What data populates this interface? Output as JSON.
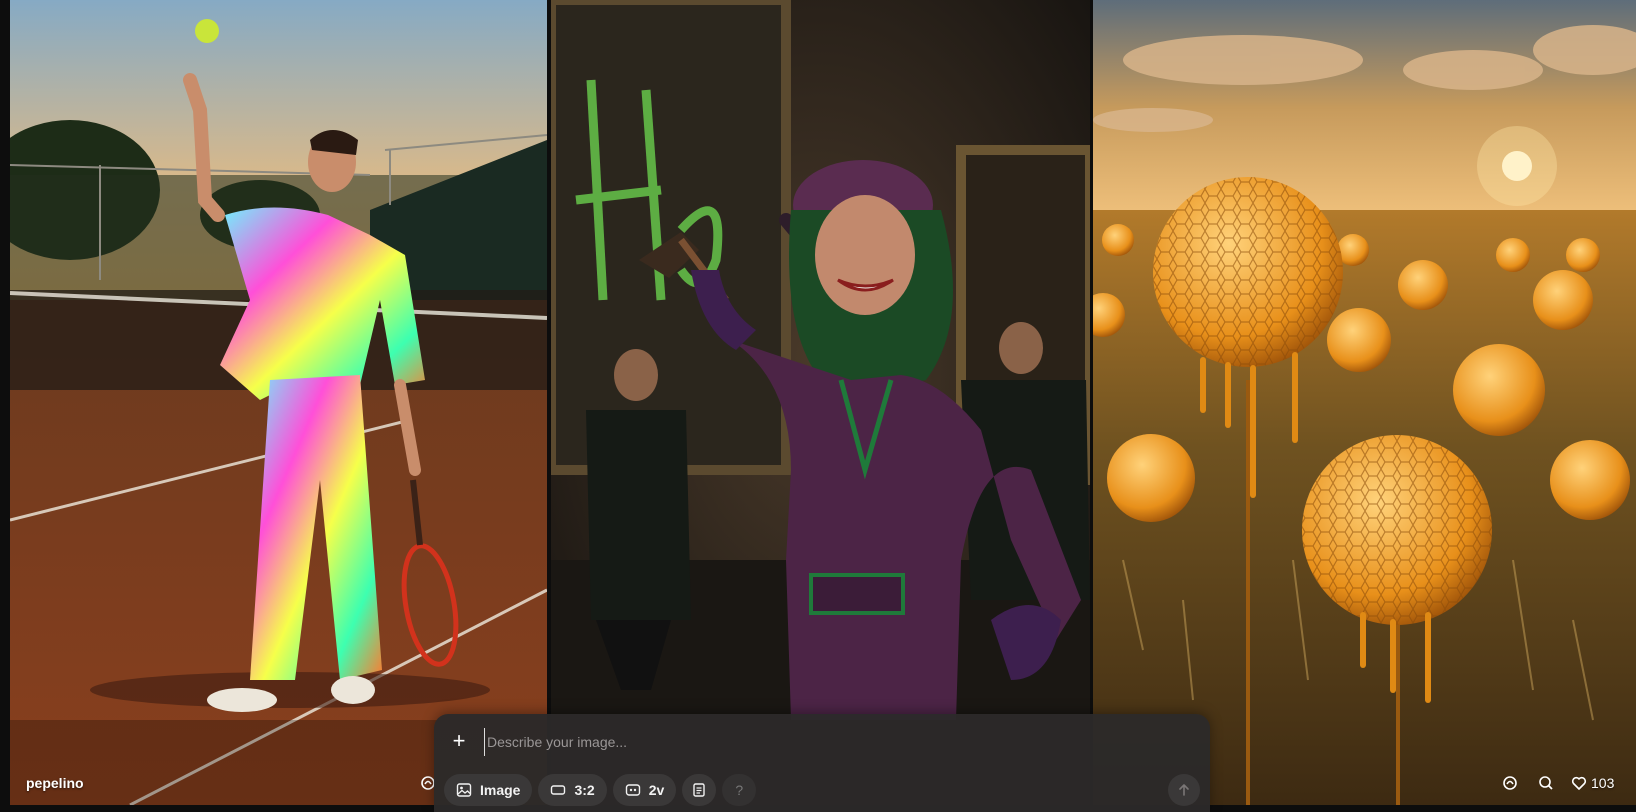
{
  "tiles": [
    {
      "author": "pepelino",
      "action_icon": "remix-icon"
    },
    {
      "action_icon": "remix-icon",
      "extra_icon": "search-icon",
      "like_icon": "heart-icon",
      "likes": "103"
    }
  ],
  "composer": {
    "add_icon": "plus-icon",
    "prompt_placeholder": "Describe your image...",
    "mode_label": "Image",
    "aspect_label": "3:2",
    "variations_label": "2v",
    "help_label": "?",
    "send_icon": "arrow-up-icon"
  }
}
